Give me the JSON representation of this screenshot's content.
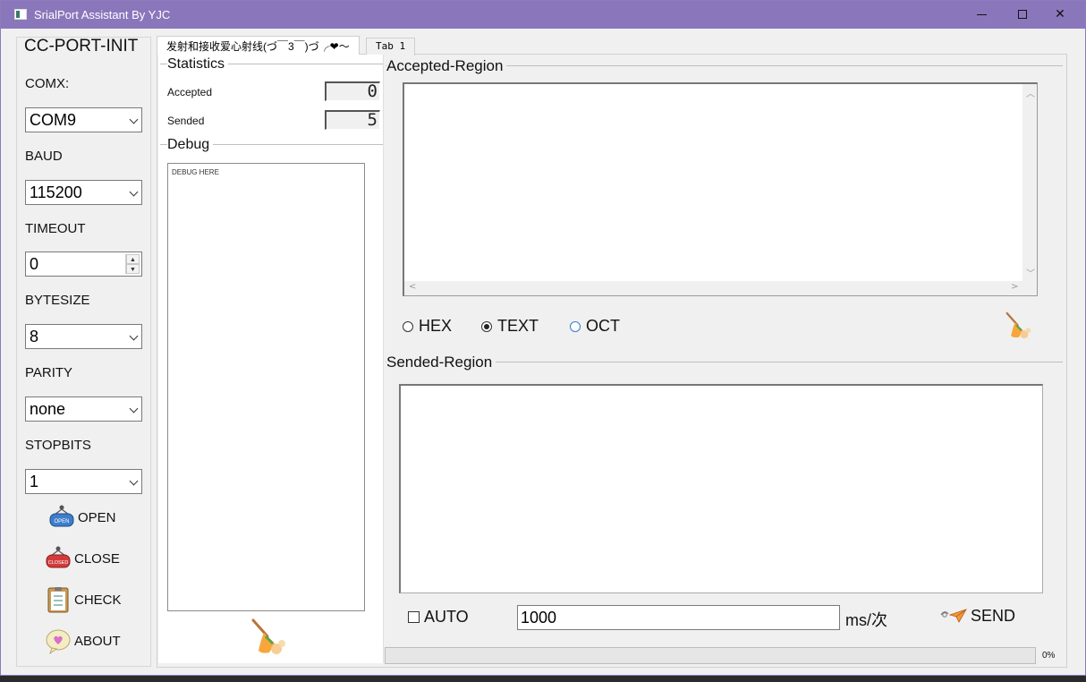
{
  "window": {
    "title": "SrialPort Assistant By YJC"
  },
  "left": {
    "title": "CC-PORT-INIT",
    "comx_label": "COMX:",
    "comx_value": "COM9",
    "baud_label": "BAUD",
    "baud_value": "115200",
    "timeout_label": "TIMEOUT",
    "timeout_value": "0",
    "bytesize_label": "BYTESIZE",
    "bytesize_value": "8",
    "parity_label": "PARITY",
    "parity_value": "none",
    "stopbits_label": "STOPBITS",
    "stopbits_value": "1",
    "open_label": "OPEN",
    "close_label": "CLOSE",
    "check_label": "CHECK",
    "about_label": "ABOUT",
    "open_icon_text": "OPEN",
    "close_icon_text": "CLOSED"
  },
  "tabs": [
    {
      "label": "发射和接收爱心射线(づ￣3￣)づ╭❤～"
    },
    {
      "label": "Tab 1"
    }
  ],
  "statistics": {
    "title": "Statistics",
    "accepted_label": "Accepted",
    "accepted_value": "0",
    "sended_label": "Sended",
    "sended_value": "5"
  },
  "debug": {
    "title": "Debug",
    "text": "DEBUG HERE"
  },
  "accepted_region": {
    "title": "Accepted-Region",
    "formats": [
      "HEX",
      "TEXT",
      "OCT"
    ],
    "selected_format": "TEXT"
  },
  "sended_region": {
    "title": "Sended-Region",
    "auto_label": "AUTO",
    "auto_checked": false,
    "interval_value": "1000",
    "interval_unit": "ms/次",
    "send_label": "SEND"
  },
  "progress": {
    "value": 0,
    "text": "0%"
  },
  "colors": {
    "titlebar": "#8a77bb",
    "window_bg": "#f0f0f0"
  }
}
